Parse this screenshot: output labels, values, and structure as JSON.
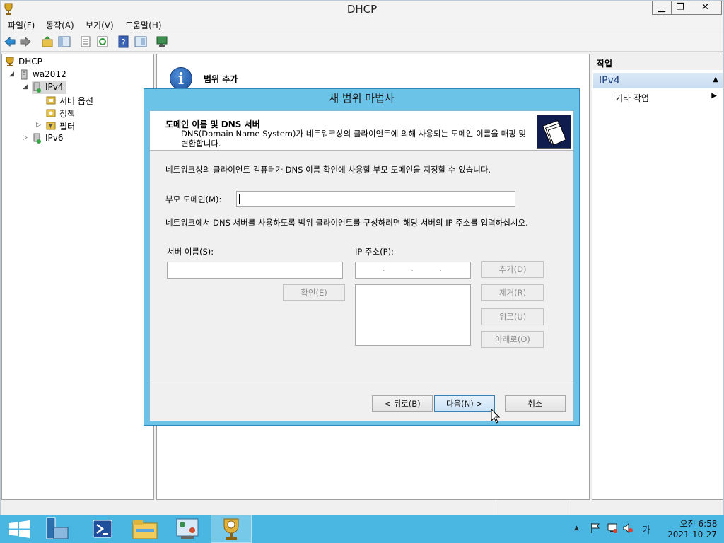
{
  "window": {
    "title": "DHCP",
    "controls": {
      "minimize": "▁",
      "maximize": "❐",
      "close": "✕"
    }
  },
  "menu": [
    "파일(F)",
    "동작(A)",
    "보기(V)",
    "도움말(H)"
  ],
  "toolbar": {
    "icons": [
      "back-icon",
      "forward-icon",
      "up-folder-icon",
      "show-hide-tree-icon",
      "export-list-icon",
      "refresh-icon",
      "help-icon",
      "properties-icon",
      "monitor-icon"
    ]
  },
  "tree": {
    "root": "DHCP",
    "server": "wa2012",
    "ipv4": "IPv4",
    "server_options": "서버 옵션",
    "policies": "정책",
    "filters": "필터",
    "ipv6": "IPv6"
  },
  "center": {
    "title": "범위 추가"
  },
  "actions": {
    "header": "작업",
    "section": "IPv4",
    "item": "기타 작업"
  },
  "wizard": {
    "title": "새 범위 마법사",
    "heading": "도메인 이름 및 DNS 서버",
    "subheading": "DNS(Domain Name System)가 네트워크상의 클라이언트에 의해 사용되는 도메인 이름을 매핑 및 변환합니다.",
    "intro": "네트워크상의 클라이언트 컴퓨터가 DNS 이름 확인에 사용할 부모 도메인을 지정할 수 있습니다.",
    "parent_domain_label": "부모 도메인(M):",
    "parent_domain_value": "",
    "dns_text": "네트워크에서 DNS 서버를 사용하도록 범위 클라이언트를 구성하려면 해당 서버의 IP 주소를 입력하십시오.",
    "server_name_label": "서버 이름(S):",
    "server_name_value": "",
    "ip_label": "IP 주소(P):",
    "ip_value": ".          .          .",
    "resolve_button": "확인(E)",
    "add_button": "추가(D)",
    "remove_button": "제거(R)",
    "up_button": "위로(U)",
    "down_button": "아래로(O)",
    "back_button": "< 뒤로(B)",
    "next_button": "다음(N) >",
    "cancel_button": "취소"
  },
  "taskbar": {
    "apps": [
      "start-icon",
      "server-manager-icon",
      "powershell-icon",
      "file-explorer-icon",
      "control-panel-icon",
      "dhcp-icon"
    ],
    "tray": {
      "ime": "가",
      "time": "오전 6:58",
      "date": "2021-10-27"
    }
  },
  "colors": {
    "wizard_frame": "#6cc3e8",
    "taskbar": "#4ab7e3",
    "accent": "#1c3f78"
  }
}
